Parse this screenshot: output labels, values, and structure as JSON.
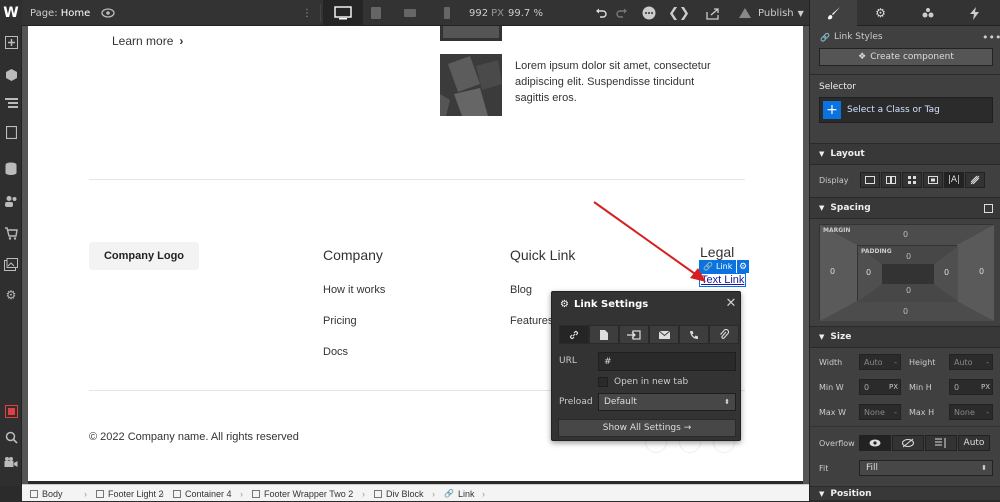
{
  "topbar": {
    "logo": "W",
    "page_label": "Page:",
    "page_name": "Home",
    "breakpoint_width": "992",
    "breakpoint_unit": "PX",
    "zoom": "99.7 %",
    "publish_label": "Publish"
  },
  "canvas": {
    "learn_more": "Learn more",
    "learn_more_chevron": "›",
    "article_text": "Lorem ipsum dolor sit amet, consectetur adipiscing elit. Suspendisse tincidunt sagittis eros.",
    "logo_button": "Company Logo",
    "col1": {
      "heading": "Company",
      "links": [
        "How it works",
        "Pricing",
        "Docs"
      ]
    },
    "col2": {
      "heading": "Quick Link",
      "links": [
        "Blog",
        "Features"
      ]
    },
    "col3": {
      "heading": "Legal",
      "link_badge": "Link",
      "text_link": "Text Link"
    },
    "copyright": "© 2022 Company name. All rights reserved"
  },
  "link_settings": {
    "title": "Link Settings",
    "tabs": [
      "link-icon",
      "page-icon",
      "section-icon",
      "email-icon",
      "phone-icon",
      "attachment-icon"
    ],
    "url_label": "URL",
    "url_value": "#",
    "open_new_tab_label": "Open in new tab",
    "preload_label": "Preload",
    "preload_value": "Default",
    "show_all_label": "Show All Settings →"
  },
  "right_panel": {
    "link_styles_label": "Link Styles",
    "create_component_label": "Create component",
    "selector_label": "Selector",
    "selector_placeholder": "Select a Class or Tag",
    "layout_label": "Layout",
    "display_label": "Display",
    "spacing_label": "Spacing",
    "margin_label": "MARGIN",
    "padding_label": "PADDING",
    "zero": "0",
    "size_label": "Size",
    "width_label": "Width",
    "height_label": "Height",
    "min_w_label": "Min W",
    "min_h_label": "Min H",
    "max_w_label": "Max W",
    "max_h_label": "Max H",
    "auto": "Auto",
    "none": "None",
    "px": "PX",
    "overflow_label": "Overflow",
    "overflow_auto": "Auto",
    "fit_label": "Fit",
    "fit_value": "Fill",
    "position_label": "Position"
  },
  "breadcrumbs": [
    "Body",
    "Footer Light 2",
    "Container 4",
    "Footer Wrapper Two 2",
    "Div Block",
    "Link"
  ],
  "colors": {
    "accent": "#0a73e0",
    "arrow": "#d42020"
  }
}
